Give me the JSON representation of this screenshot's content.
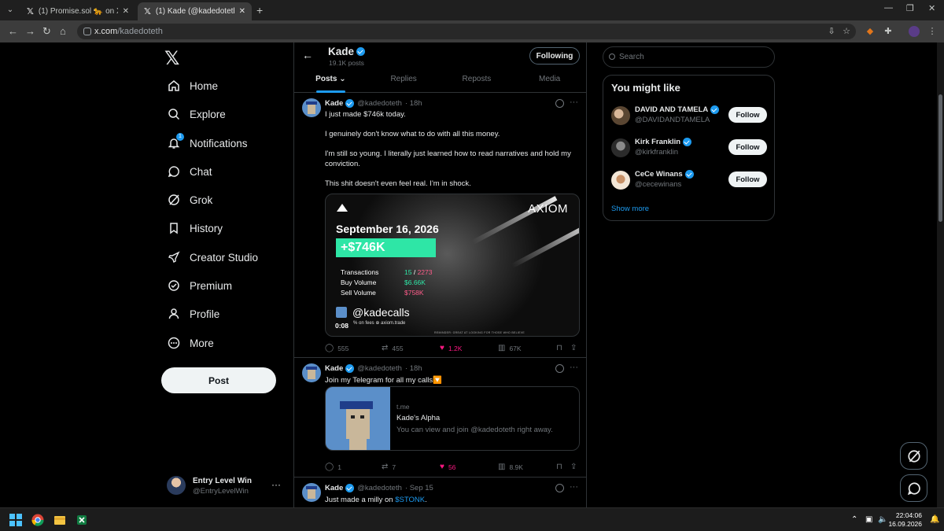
{
  "browser": {
    "tabs": [
      {
        "title": "(1) Promise.sol 🐆 on X: \"$50 to",
        "active": false
      },
      {
        "title": "(1) Kade (@kadedoteth) / X",
        "active": true
      }
    ],
    "url_domain": "x.com",
    "url_path": "/kadedoteth"
  },
  "nav": {
    "items": [
      {
        "label": "Home",
        "icon": "home-icon"
      },
      {
        "label": "Explore",
        "icon": "search-icon"
      },
      {
        "label": "Notifications",
        "icon": "bell-icon",
        "badge": "1"
      },
      {
        "label": "Chat",
        "icon": "chat-icon"
      },
      {
        "label": "Grok",
        "icon": "grok-icon"
      },
      {
        "label": "History",
        "icon": "bookmark-icon"
      },
      {
        "label": "Creator Studio",
        "icon": "rocket-icon"
      },
      {
        "label": "Premium",
        "icon": "verified-icon"
      },
      {
        "label": "Profile",
        "icon": "person-icon"
      },
      {
        "label": "More",
        "icon": "more-icon"
      }
    ],
    "post_label": "Post",
    "account": {
      "name": "Entry Level Win",
      "handle": "@EntryLevelWin",
      "more": "···"
    }
  },
  "profile": {
    "name": "Kade",
    "post_count": "19.1K posts",
    "following_label": "Following",
    "tabs": [
      "Posts",
      "Replies",
      "Reposts",
      "Media"
    ],
    "active_tab": "Posts"
  },
  "tweets": [
    {
      "name": "Kade",
      "handle": "@kadedoteth",
      "time": "· 18h",
      "lines": [
        "I just made $746k today.",
        "I genuinely don't know what to do with all this money.",
        "I'm still so young. I literally just learned how to read narratives and hold my conviction.",
        "This shit doesn't even feel real. I'm in shock."
      ],
      "replies": "555",
      "reposts": "455",
      "likes": "1.2K",
      "views": "67K",
      "media": {
        "brand": "AXIOM",
        "date": "September 16, 2026",
        "pnl": "+$746K",
        "rows": [
          {
            "label": "Transactions",
            "value_a": "15",
            "sep": " / ",
            "value_b": "2273"
          },
          {
            "label": "Buy Volume",
            "value": "$6.66K"
          },
          {
            "label": "Sell Volume",
            "value": "$758K"
          }
        ],
        "handle": "@kadecalls",
        "footer": "% on fees  ⊕ axiom.trade",
        "timer": "0:08",
        "fine_print": "REMINDER: GREAT AT LOOKING FOR THOSE WHO BELIEVE"
      }
    },
    {
      "name": "Kade",
      "handle": "@kadedoteth",
      "time": "· 18h",
      "text": "Join my Telegram for all my calls🔽",
      "card": {
        "domain": "t.me",
        "title": "Kade's Alpha",
        "desc": "You can view and join @kadedoteth right away."
      },
      "replies": "1",
      "reposts": "7",
      "likes": "56",
      "views": "8.9K"
    },
    {
      "name": "Kade",
      "handle": "@kadedoteth",
      "time": "· Sep 15",
      "text_before": "Just made a milly on ",
      "cashtag": "$STONK",
      "text_after": "."
    }
  ],
  "right": {
    "search_placeholder": "Search",
    "wtf_title": "You might like",
    "suggestions": [
      {
        "name": "DAVID AND TAMELA",
        "handle": "@DAVIDANDTAMELA",
        "follow": "Follow"
      },
      {
        "name": "Kirk Franklin",
        "handle": "@kirkfranklin",
        "follow": "Follow"
      },
      {
        "name": "CeCe Winans",
        "handle": "@cecewinans",
        "follow": "Follow"
      }
    ],
    "show_more": "Show more"
  },
  "taskbar": {
    "time": "22:04:06",
    "date": "16.09.2026"
  },
  "colors": {
    "accent": "#1d9bf0",
    "like": "#f91880",
    "pnl": "#2ee6a6",
    "sell": "#ff5c8a",
    "buy": "#2ee6a6"
  }
}
